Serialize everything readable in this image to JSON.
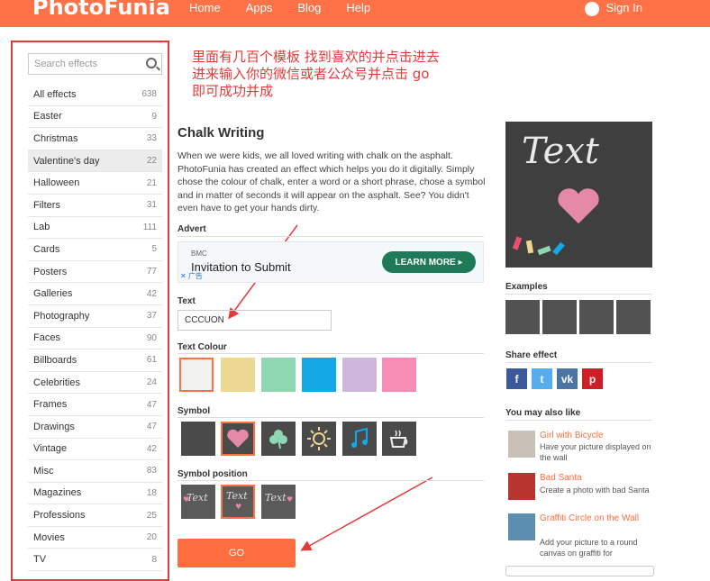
{
  "header": {
    "logo": "PhotoFunia",
    "nav": [
      "Home",
      "Apps",
      "Blog",
      "Help"
    ],
    "signin": "Sign In",
    "bg_color": "#ff7146"
  },
  "annotation": {
    "line1": "里面有几百个模板 找到喜欢的并点击进去",
    "line2": "进来输入你的微信或者公众号并点击 go",
    "line3": "即可成功并成",
    "color": "#e53a3a"
  },
  "sidebar": {
    "search_placeholder": "Search effects",
    "items": [
      {
        "label": "All effects",
        "count": "638"
      },
      {
        "label": "Easter",
        "count": "9"
      },
      {
        "label": "Christmas",
        "count": "33"
      },
      {
        "label": "Valentine's day",
        "count": "22"
      },
      {
        "label": "Halloween",
        "count": "21"
      },
      {
        "label": "Filters",
        "count": "31"
      },
      {
        "label": "Lab",
        "count": "111"
      },
      {
        "label": "Cards",
        "count": "5"
      },
      {
        "label": "Posters",
        "count": "77"
      },
      {
        "label": "Galleries",
        "count": "42"
      },
      {
        "label": "Photography",
        "count": "37"
      },
      {
        "label": "Faces",
        "count": "90"
      },
      {
        "label": "Billboards",
        "count": "61"
      },
      {
        "label": "Celebrities",
        "count": "24"
      },
      {
        "label": "Frames",
        "count": "47"
      },
      {
        "label": "Drawings",
        "count": "47"
      },
      {
        "label": "Vintage",
        "count": "42"
      },
      {
        "label": "Misc",
        "count": "83"
      },
      {
        "label": "Magazines",
        "count": "18"
      },
      {
        "label": "Professions",
        "count": "25"
      },
      {
        "label": "Movies",
        "count": "20"
      },
      {
        "label": "TV",
        "count": "8"
      }
    ]
  },
  "main": {
    "title": "Chalk Writing",
    "description": "When we were kids, we all loved writing with chalk on the asphalt. PhotoFunia has created an effect which helps you do it digitally. Simply chose the colour of chalk, enter a word or a short phrase, chose a symbol and in matter of seconds it will appear on the asphalt. See? You didn't even have to get your hands dirty.",
    "advert_label": "Advert",
    "ad": {
      "brand": "BMC",
      "text": "Invitation to Submit",
      "marks": "✕ 广告",
      "button": "LEARN MORE ▸"
    },
    "text_label": "Text",
    "text_value": "CCCUON",
    "colour_label": "Text Colour",
    "colours": [
      "#f2f2ee",
      "#ecd893",
      "#8fd6b2",
      "#12a9e6",
      "#cfb6dc",
      "#f58db5"
    ],
    "symbol_label": "Symbol",
    "symbols": [
      "none",
      "heart-icon",
      "clover-icon",
      "sun-icon",
      "music-note-icon",
      "coffee-cup-icon"
    ],
    "position_label": "Symbol position",
    "position_text": "Text",
    "go_label": "GO"
  },
  "right": {
    "preview_text": "Text",
    "examples_label": "Examples",
    "share_label": "Share effect",
    "share": [
      {
        "glyph": "f",
        "color": "#3b5998"
      },
      {
        "glyph": "t",
        "color": "#55acee"
      },
      {
        "glyph": "vk",
        "color": "#4c75a3"
      },
      {
        "glyph": "p",
        "color": "#cb2027"
      }
    ],
    "also_label": "You may also like",
    "also": [
      {
        "title": "Girl with Bicycle",
        "desc": "Have your picture displayed on the wall"
      },
      {
        "title": "Bad Santa",
        "desc": "Create a photo with bad Santa"
      },
      {
        "title": "Graffiti Circle on the Wall",
        "desc": "Add your picture to a round canvas on graffiti for"
      }
    ]
  }
}
